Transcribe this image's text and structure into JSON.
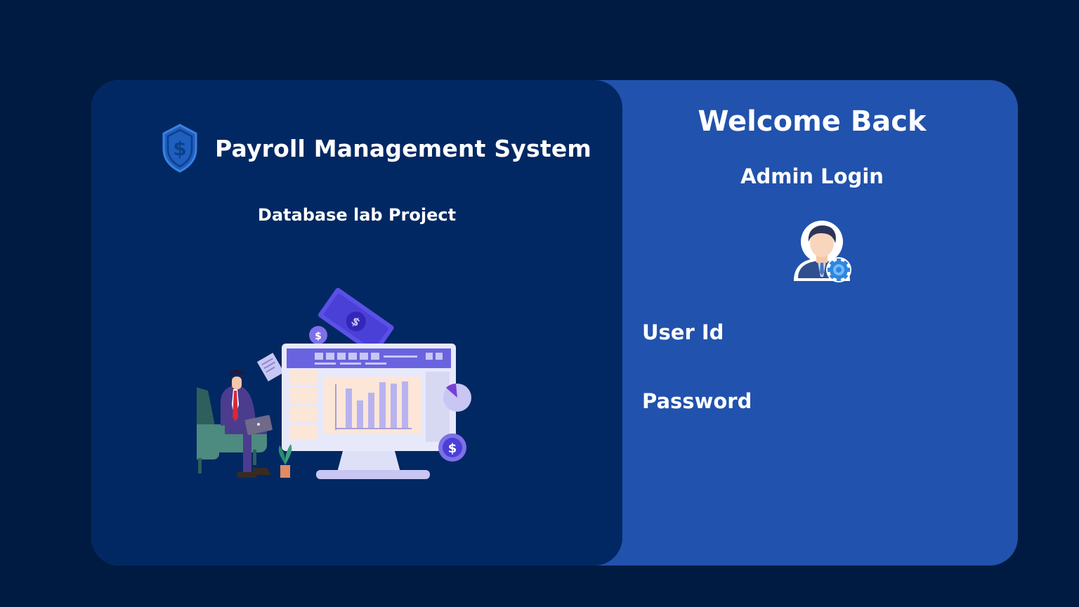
{
  "brand": {
    "title": "Payroll Management System",
    "subtitle": "Database lab Project",
    "logo_icon": "dollar-shield-icon"
  },
  "login": {
    "welcome": "Welcome Back",
    "heading": "Admin Login",
    "avatar_icon": "admin-user-gear-icon",
    "user_id_label": "User Id",
    "user_id_value": "",
    "password_label": "Password",
    "password_value": ""
  },
  "colors": {
    "page_background": "#001b42",
    "left_panel": "#022863",
    "right_panel": "#2152ad",
    "text": "#ffffff"
  }
}
